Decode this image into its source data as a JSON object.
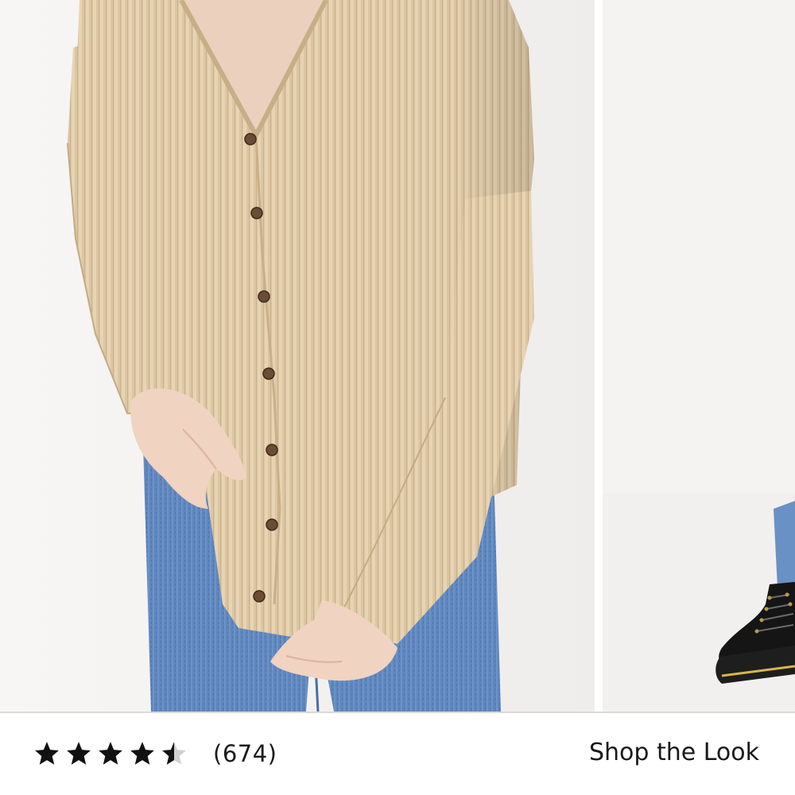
{
  "product_gallery": {
    "images": [
      {
        "alt": "Model wearing a beige waffle-knit button-front cardigan with blue jeans"
      },
      {
        "alt": "Model wearing black lace-up combat boots with blue jeans"
      }
    ]
  },
  "rating": {
    "value": 4.5,
    "max": 5,
    "count_label": "(674)"
  },
  "shop_the_look": {
    "label": "Shop the Look"
  },
  "colors": {
    "text": "#1a1a1a",
    "star_filled": "#111111",
    "star_empty": "#cfcfcf",
    "divider": "#d9d9d9"
  }
}
